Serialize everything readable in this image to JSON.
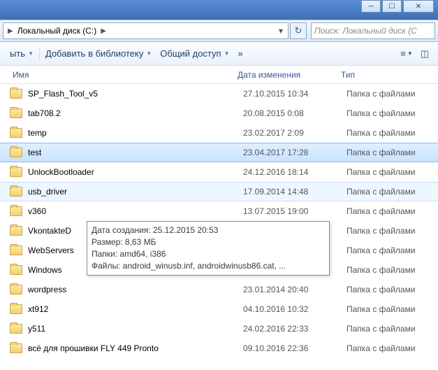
{
  "breadcrumb": {
    "label": "Локальный диск (C:)"
  },
  "search": {
    "placeholder": "Поиск: Локальный диск (C"
  },
  "toolbar": {
    "organize_suffix": "ыть",
    "add_to_library": "Добавить в библиотеку",
    "share": "Общий доступ",
    "overflow": "»"
  },
  "columns": {
    "name": "Имя",
    "date": "Дата изменения",
    "type": "Тип"
  },
  "type_label": "Папка с файлами",
  "rows": [
    {
      "name": "SP_Flash_Tool_v5",
      "date": "27.10.2015 10:34",
      "state": ""
    },
    {
      "name": "tab708.2",
      "date": "20.08.2015 0:08",
      "state": ""
    },
    {
      "name": "temp",
      "date": "23.02.2017 2:09",
      "state": ""
    },
    {
      "name": "test",
      "date": "23.04.2017 17:28",
      "state": "selected"
    },
    {
      "name": "UnlockBootloader",
      "date": "24.12.2016 18:14",
      "state": ""
    },
    {
      "name": "usb_driver",
      "date": "17.09.2014 14:48",
      "state": "hover"
    },
    {
      "name": "v360",
      "date": "13.07.2015 19:00",
      "state": ""
    },
    {
      "name": "VkontakteD",
      "date": "",
      "state": ""
    },
    {
      "name": "WebServers",
      "date": "",
      "state": ""
    },
    {
      "name": "Windows",
      "date": "",
      "state": ""
    },
    {
      "name": "wordpress",
      "date": "23.01.2014 20:40",
      "state": ""
    },
    {
      "name": "xt912",
      "date": "04.10.2016 10:32",
      "state": ""
    },
    {
      "name": "y511",
      "date": "24.02.2016 22:33",
      "state": ""
    },
    {
      "name": "всё для прошивки FLY 449 Pronto",
      "date": "09.10.2016 22:36",
      "state": ""
    }
  ],
  "tooltip": {
    "line1": "Дата создания: 25.12.2015 20:53",
    "line2": "Размер: 8,63 МБ",
    "line3": "Папки: amd64, i386",
    "line4": "Файлы: android_winusb.inf, androidwinusb86.cat, ..."
  }
}
